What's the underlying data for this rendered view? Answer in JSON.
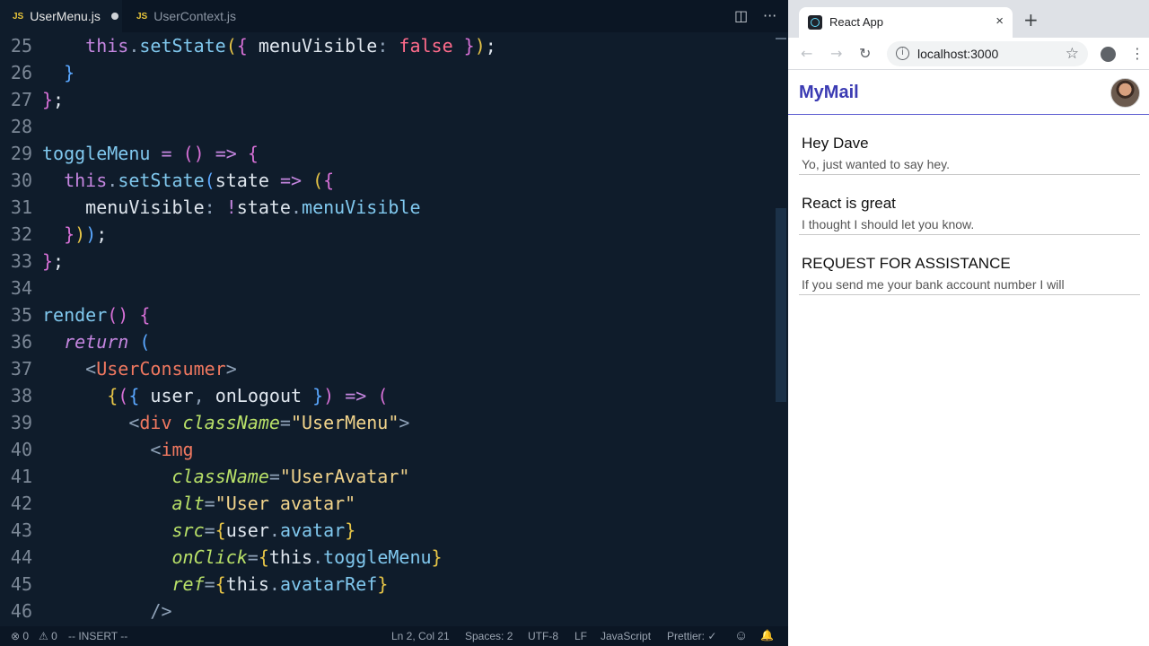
{
  "editor": {
    "tabs": [
      {
        "badge": "JS",
        "label": "UserMenu.js",
        "active": true,
        "modified": true
      },
      {
        "badge": "JS",
        "label": "UserContext.js",
        "active": false,
        "modified": false
      }
    ],
    "actions": {
      "split": "◫",
      "more": "···"
    },
    "status": {
      "errors": "⊗ 0",
      "warnings": "⚠ 0",
      "mode": "-- INSERT --",
      "position": "Ln 2, Col 21",
      "spaces": "Spaces: 2",
      "encoding": "UTF-8",
      "eol": "LF",
      "language": "JavaScript",
      "prettier": "Prettier: ✓",
      "smiley": "☺",
      "bell": "🔔"
    }
  },
  "browser": {
    "tab_title": "React App",
    "tab_close": "×",
    "new_tab": "+",
    "url": "localhost:3000",
    "nav": {
      "back": "←",
      "forward": "→",
      "reload": "↻",
      "star": "☆",
      "menu": "⋮"
    },
    "app": {
      "brand": "MyMail",
      "messages": [
        {
          "subject": "Hey Dave",
          "preview": "Yo, just wanted to say hey."
        },
        {
          "subject": "React is great",
          "preview": "I thought I should let you know."
        },
        {
          "subject": "REQUEST FOR ASSISTANCE",
          "preview": "If you send me your bank account number I will"
        }
      ]
    }
  }
}
